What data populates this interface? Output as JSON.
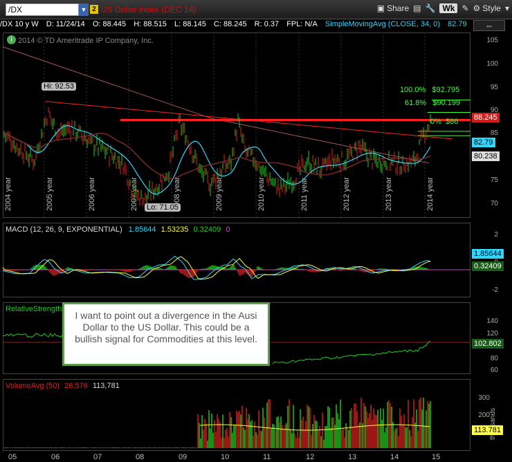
{
  "toolbar": {
    "symbol": "/DX",
    "link_badge": "2",
    "description": "US Dollar Index (DEC 14)",
    "share_label": "Share",
    "wk_label": "Wk",
    "style_label": "Style"
  },
  "info": {
    "symbol_period": "/DX 10 y W",
    "date": "D: 11/24/14",
    "open": "O: 88.445",
    "high": "H: 88.515",
    "low": "L: 88.145",
    "close": "C: 88.245",
    "range": "R: 0.37",
    "fpl": "FPL: N/A",
    "sma_label": "SimpleMovingAvg (CLOSE, 34, 0)",
    "sma_value": "82.79"
  },
  "price_panel": {
    "copyright": "2014 © TD Ameritrade IP Company, Inc.",
    "hi_label": "Hi: 92.53",
    "lo_label": "Lo: 71.05",
    "fib": [
      {
        "pct": "100.0%",
        "val": "$92.795"
      },
      {
        "pct": "61.8%",
        "val": "$90.199"
      },
      {
        "pct": "0%",
        "val": "$86"
      }
    ],
    "year_labels": [
      "2004 year",
      "2005 year",
      "2006 year",
      "2007 year",
      "2008 year",
      "2009 year",
      "2010 year",
      "2011 year",
      "2012 year",
      "2013 year",
      "2014 year"
    ],
    "y_ticks": [
      "105",
      "100",
      "95",
      "90",
      "85",
      "80",
      "75",
      "70"
    ],
    "tags": {
      "price": "88.245",
      "sma": "82.79",
      "ma2": "80.238"
    }
  },
  "macd_panel": {
    "title": "MACD (12, 26, 9, EXPONENTIAL)",
    "v1": "1.85644",
    "v2": "1.53235",
    "v3": "0.32409",
    "v4": "0",
    "y_ticks": [
      "2",
      "0",
      "-2"
    ],
    "tags": {
      "macd": "1.85644",
      "diff": "0.32409"
    }
  },
  "rs_panel": {
    "title": "RelativeStrength",
    "y_ticks": [
      "140",
      "120",
      "100",
      "80",
      "60"
    ],
    "tag": "102.802"
  },
  "volume_panel": {
    "title": "VolumeAvg (50)",
    "v1": "26,576",
    "v2": "113,781",
    "y_ticks": [
      "300",
      "200",
      "100"
    ],
    "tag": "113.781",
    "unit": "thousands"
  },
  "x_axis": [
    "05",
    "06",
    "07",
    "08",
    "09",
    "10",
    "11",
    "12",
    "13",
    "14",
    "15"
  ],
  "note": "I want to point out a divergence in the Ausi Dollar to the US Dollar.  This could be a bullish signal for Commodities at this level.",
  "colors": {
    "up": "#1fd11f",
    "down": "#e02020",
    "sma": "#2fd7ff",
    "ma2": "#7a2a2a",
    "fib": "#3cff3c",
    "resist": "#ff2020"
  }
}
